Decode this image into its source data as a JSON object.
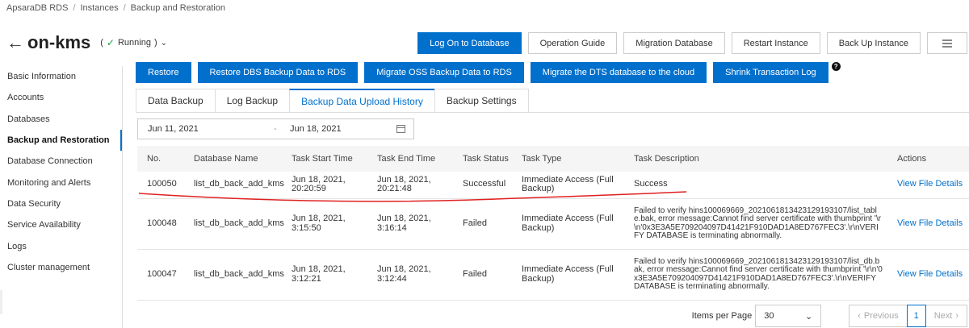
{
  "breadcrumb": [
    "ApsaraDB RDS",
    "Instances",
    "Backup and Restoration"
  ],
  "title": "on-kms",
  "status": "Running",
  "top_actions": [
    "Log On to Database",
    "Operation Guide",
    "Migration Database",
    "Restart Instance",
    "Back Up Instance"
  ],
  "sidebar": [
    "Basic Information",
    "Accounts",
    "Databases",
    "Backup and Restoration",
    "Database Connection",
    "Monitoring and Alerts",
    "Data Security",
    "Service Availability",
    "Logs",
    "Cluster management"
  ],
  "actions": [
    "Restore",
    "Restore DBS Backup Data to RDS",
    "Migrate OSS Backup Data to RDS",
    "Migrate the DTS database to the cloud",
    "Shrink Transaction Log"
  ],
  "tabs": [
    "Data Backup",
    "Log Backup",
    "Backup Data Upload History",
    "Backup Settings"
  ],
  "date_range": {
    "start": "Jun 11, 2021",
    "sep": "-",
    "end": "Jun 18, 2021"
  },
  "columns": [
    "No.",
    "Database Name",
    "Task Start Time",
    "Task End Time",
    "Task Status",
    "Task Type",
    "Task Description",
    "Actions"
  ],
  "rows": [
    {
      "no": "100050",
      "db": "list_db_back_add_kms",
      "start": "Jun 18, 2021, 20:20:59",
      "end": "Jun 18, 2021, 20:21:48",
      "status": "Successful",
      "type": "Immediate Access (Full Backup)",
      "desc": "Success",
      "action": "View File Details"
    },
    {
      "no": "100048",
      "db": "list_db_back_add_kms",
      "start": "Jun 18, 2021, 3:15:50",
      "end": "Jun 18, 2021, 3:16:14",
      "status": "Failed",
      "type": "Immediate Access (Full Backup)",
      "desc": "Failed to verify hins100069669_20210618134231​29193107/list_table.bak, error message:Cannot find server certificate with thumbprint '\\r\\n'0x3E3A5E709204097D41421F910DAD1A8ED767FEC3'.\\r\\nVERIFY DATABASE is terminating abnormally.",
      "action": "View File Details"
    },
    {
      "no": "100047",
      "db": "list_db_back_add_kms",
      "start": "Jun 18, 2021, 3:12:21",
      "end": "Jun 18, 2021, 3:12:44",
      "status": "Failed",
      "type": "Immediate Access (Full Backup)",
      "desc": "Failed to verify hins100069669_20210618134231​29193107/list_db.bak, error message:Cannot find server certificate with thumbprint '\\r\\n'0x3E3A5E709204097D41421F910DAD1A8ED767FEC3'.\\r\\nVERIFY DATABASE is terminating abnormally.",
      "action": "View File Details"
    }
  ],
  "pagination": {
    "items_label": "Items per Page",
    "page_size": "30",
    "prev": "Previous",
    "page": "1",
    "next": "Next"
  },
  "colors": {
    "primary": "#0070cc",
    "success": "#1e9e40",
    "annotation": "#e02020"
  }
}
